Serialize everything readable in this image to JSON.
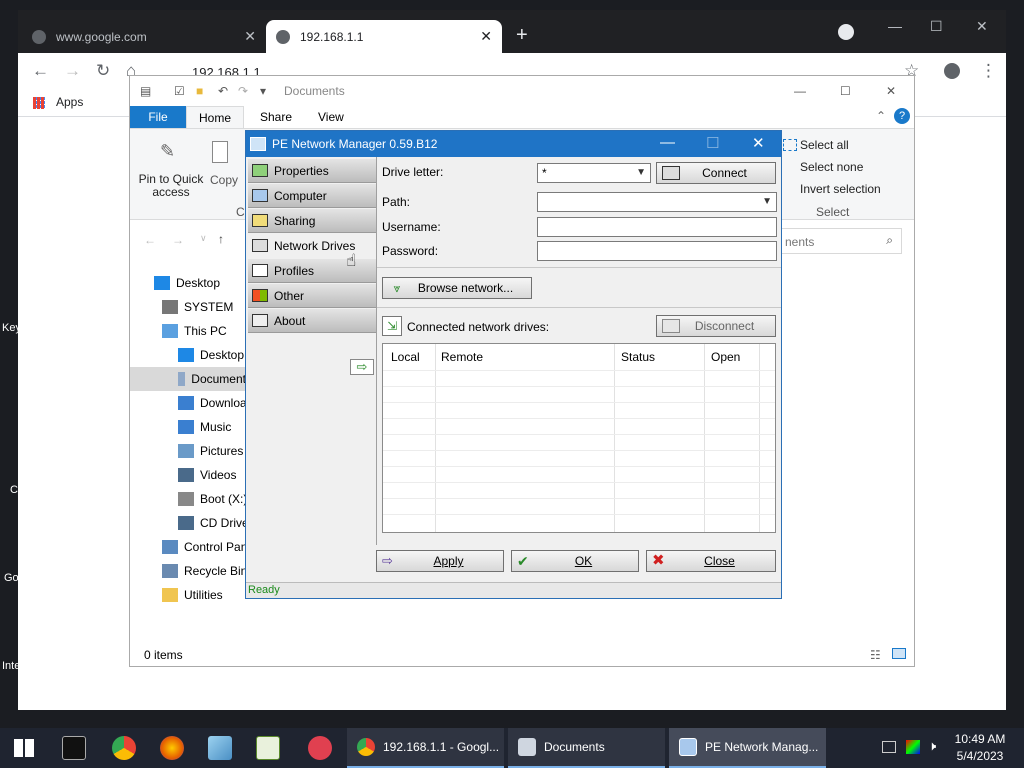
{
  "desktop": {
    "side_labels": [
      "Key",
      "C",
      "Go",
      "Inte"
    ]
  },
  "browser": {
    "tabs": [
      {
        "title": "www.google.com",
        "active": false
      },
      {
        "title": "192.168.1.1",
        "active": true
      }
    ],
    "address": "192.168.1.1",
    "bookmarks": {
      "apps_label": "Apps"
    }
  },
  "explorer": {
    "title": "Documents",
    "ribbon_tabs": [
      "File",
      "Home",
      "Share",
      "View"
    ],
    "ribbon": {
      "pin_label": "Pin to Quick access",
      "copy_label": "Copy",
      "clip_label": "Cl",
      "select_all": "Select all",
      "select_none": "Select none",
      "invert_selection": "Invert selection",
      "select_group": "Select"
    },
    "search_placeholder": "nents",
    "nav": [
      {
        "label": "Desktop",
        "indent": 0
      },
      {
        "label": "SYSTEM",
        "indent": 1
      },
      {
        "label": "This PC",
        "indent": 1
      },
      {
        "label": "Desktop",
        "indent": 2
      },
      {
        "label": "Document",
        "indent": 2,
        "selected": true
      },
      {
        "label": "Download",
        "indent": 2
      },
      {
        "label": "Music",
        "indent": 2
      },
      {
        "label": "Pictures",
        "indent": 2
      },
      {
        "label": "Videos",
        "indent": 2
      },
      {
        "label": "Boot (X:)",
        "indent": 2
      },
      {
        "label": "CD Drive (",
        "indent": 2
      },
      {
        "label": "Control Pan",
        "indent": 1
      },
      {
        "label": "Recycle Bin",
        "indent": 1
      },
      {
        "label": "Utilities",
        "indent": 1
      }
    ],
    "status": "0 items"
  },
  "pe": {
    "title": "PE Network Manager 0.59.B12",
    "tabs": [
      "Properties",
      "Computer",
      "Sharing",
      "Network Drives",
      "Profiles",
      "Other",
      "About"
    ],
    "selected_tab": "Network Drives",
    "drive_letter_label": "Drive letter:",
    "drive_letter_value": "*",
    "connect_label": "Connect",
    "path_label": "Path:",
    "path_value": "",
    "username_label": "Username:",
    "username_value": "",
    "password_label": "Password:",
    "password_value": "",
    "browse_label": "Browse network...",
    "connected_label": "Connected network drives:",
    "disconnect_label": "Disconnect",
    "columns": [
      "Local",
      "Remote",
      "Status",
      "Open"
    ],
    "apply_label": "Apply",
    "ok_label": "OK",
    "close_label": "Close",
    "status": "Ready"
  },
  "taskbar": {
    "windows": [
      {
        "label": "192.168.1.1 - Googl..."
      },
      {
        "label": "Documents"
      },
      {
        "label": "PE Network Manag..."
      }
    ],
    "time": "10:49 AM",
    "date": "5/4/2023"
  }
}
